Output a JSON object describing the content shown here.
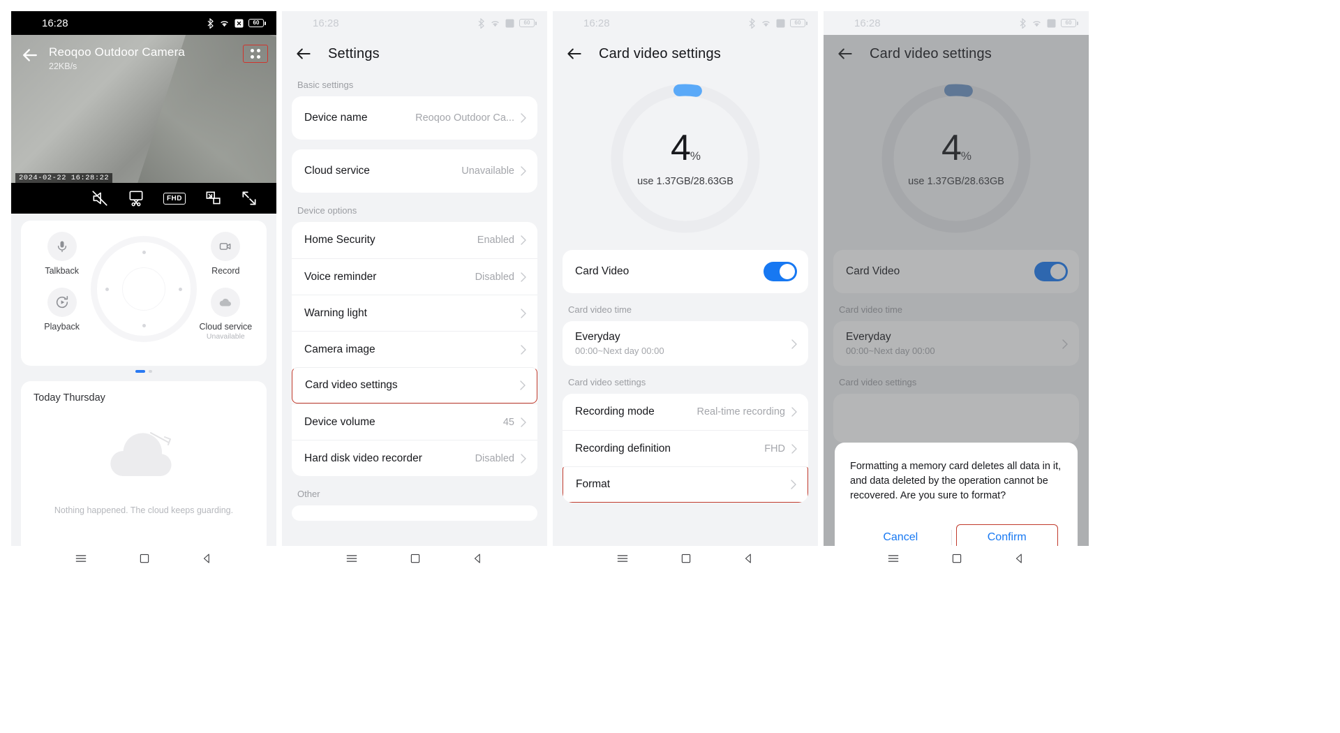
{
  "status_bar": {
    "time": "16:28",
    "battery": "60"
  },
  "phone1": {
    "video": {
      "title": "Reoqoo Outdoor Camera",
      "bitrate": "22KB/s",
      "timestamp": "2024-02-22  16:28:22",
      "quality_label": "FHD",
      "controls": [
        "mute-icon",
        "snapshot-icon",
        "quality-fhd",
        "pip-icon",
        "fullscreen-icon"
      ]
    },
    "controls": [
      {
        "label": "Talkback",
        "sub": "",
        "icon": "microphone-icon"
      },
      {
        "label": "Record",
        "sub": "",
        "icon": "video-camera-icon"
      },
      {
        "label": "Playback",
        "sub": "",
        "icon": "play-circle-icon"
      },
      {
        "label": "Cloud service",
        "sub": "Unavailable",
        "icon": "cloud-icon"
      }
    ],
    "today": {
      "title": "Today Thursday",
      "empty_text": "Nothing happened. The cloud keeps guarding."
    }
  },
  "phone2": {
    "title": "Settings",
    "sections": [
      {
        "label": "Basic settings",
        "rows": [
          {
            "label": "Device name",
            "value": "Reoqoo Outdoor Ca..."
          }
        ]
      },
      {
        "label": "",
        "rows": [
          {
            "label": "Cloud service",
            "value": "Unavailable"
          }
        ]
      },
      {
        "label": "Device options",
        "rows": [
          {
            "label": "Home Security",
            "value": "Enabled"
          },
          {
            "label": "Voice reminder",
            "value": "Disabled"
          },
          {
            "label": "Warning light",
            "value": ""
          },
          {
            "label": "Camera image",
            "value": ""
          },
          {
            "label": "Card video settings",
            "value": "",
            "highlight": true
          },
          {
            "label": "Device volume",
            "value": "45"
          },
          {
            "label": "Hard disk video recorder",
            "value": "Disabled"
          }
        ]
      },
      {
        "label": "Other",
        "rows": []
      }
    ]
  },
  "phone3": {
    "title": "Card video settings",
    "gauge": {
      "percent": "4",
      "percent_unit": "%",
      "usage": "use 1.37GB/28.63GB",
      "arc_color": "#5aa9f8",
      "track_color": "#ebecef"
    },
    "card_video": {
      "label": "Card Video",
      "enabled": true
    },
    "time_section": {
      "label": "Card video time",
      "row_title": "Everyday",
      "row_sub": "00:00~Next day 00:00"
    },
    "settings_section": {
      "label": "Card video settings",
      "rows": [
        {
          "label": "Recording mode",
          "value": "Real-time recording"
        },
        {
          "label": "Recording definition",
          "value": "FHD"
        },
        {
          "label": "Format",
          "value": "",
          "highlight": true
        }
      ]
    }
  },
  "phone4": {
    "title": "Card video settings",
    "gauge": {
      "percent": "4",
      "percent_unit": "%",
      "usage": "use 1.37GB/28.63GB",
      "arc_color": "#6b93c4",
      "track_color": "#e4e5e8"
    },
    "card_video": {
      "label": "Card Video",
      "enabled": true
    },
    "time_section": {
      "label": "Card video time",
      "row_title": "Everyday",
      "row_sub": "00:00~Next day 00:00"
    },
    "settings_section_label": "Card video settings",
    "dialog": {
      "message": "Formatting a memory card deletes all data in it, and data deleted by the operation cannot be recovered. Are you sure to format?",
      "cancel_label": "Cancel",
      "confirm_label": "Confirm"
    }
  },
  "navbar": {
    "menu": "menu-icon",
    "home": "home-square-icon",
    "back": "back-triangle-icon"
  }
}
